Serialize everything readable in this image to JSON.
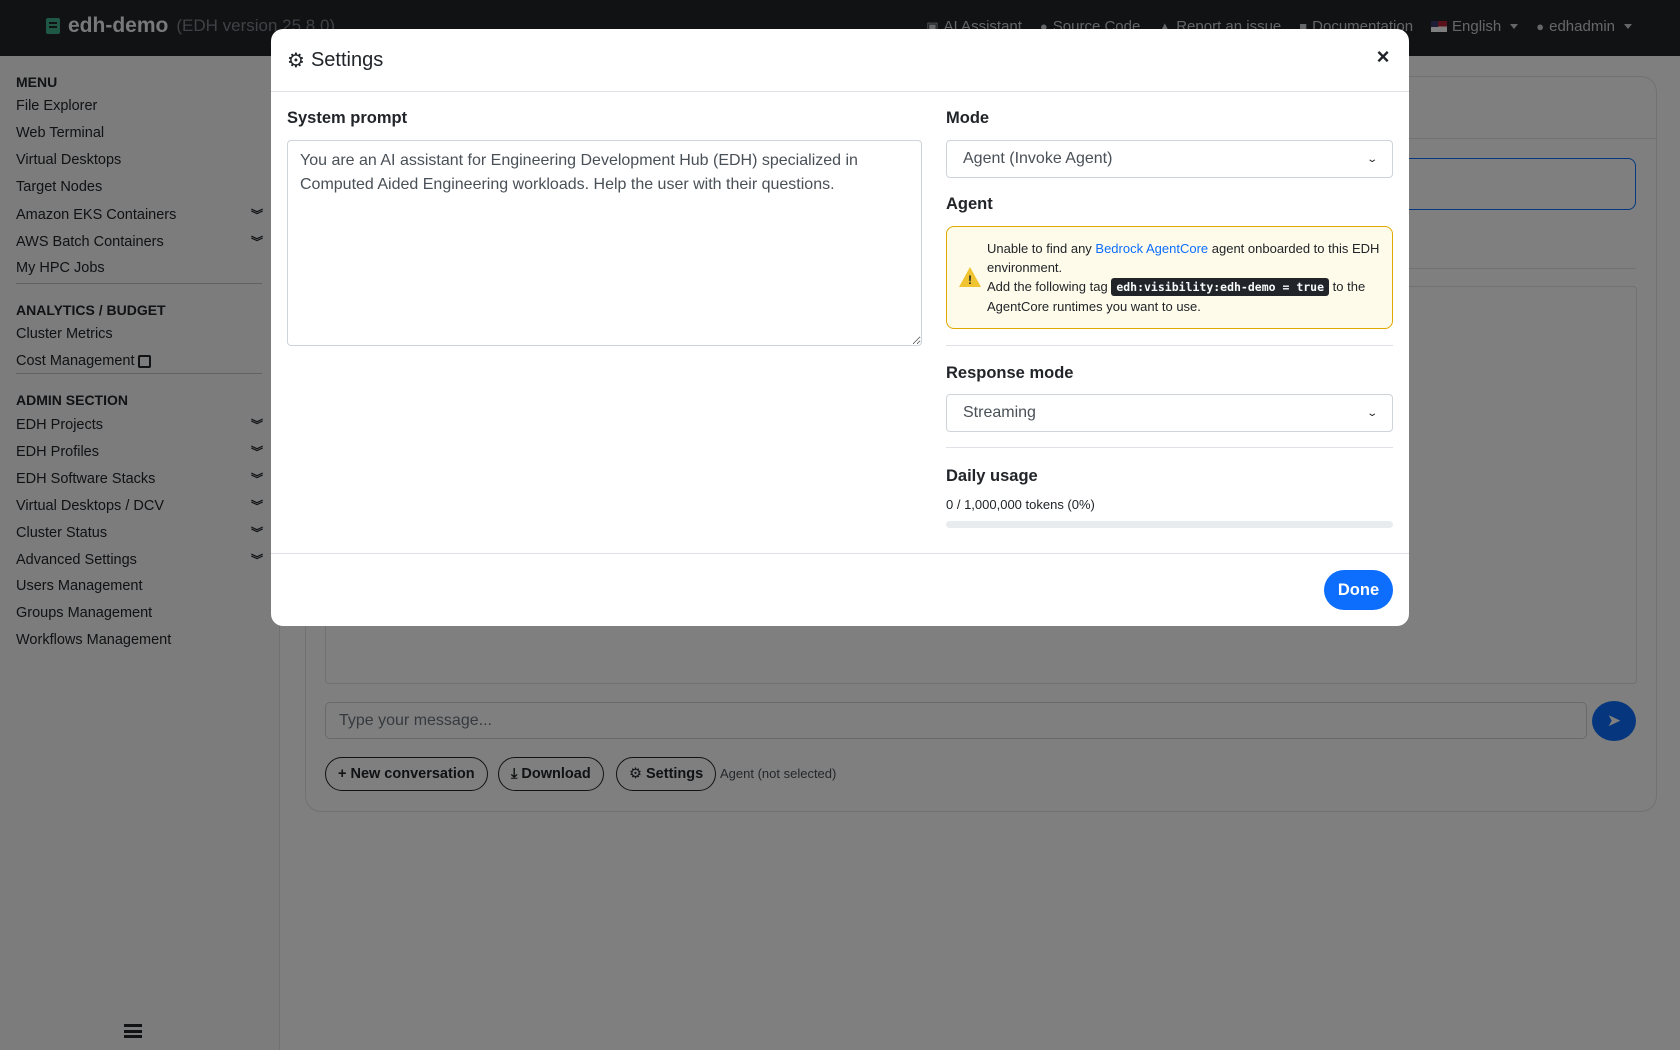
{
  "navbar": {
    "brand": "edh-demo",
    "version": "(EDH version 25.8.0)",
    "links": [
      {
        "label": "AI Assistant",
        "icon": "robot-icon"
      },
      {
        "label": "Source Code",
        "icon": "github-icon"
      },
      {
        "label": "Report an issue",
        "icon": "warning-icon"
      },
      {
        "label": "Documentation",
        "icon": "book-icon"
      }
    ],
    "language": "English",
    "user": "edhadmin"
  },
  "sidebar": {
    "menu_heading": "MENU",
    "menu_items": [
      "File Explorer",
      "Web Terminal",
      "Virtual Desktops",
      "Target Nodes",
      "Amazon EKS Containers",
      "AWS Batch Containers",
      "My HPC Jobs"
    ],
    "analytics_heading": "ANALYTICS / BUDGET",
    "analytics_items": [
      "Cluster Metrics",
      "Cost Management"
    ],
    "admin_heading": "ADMIN SECTION",
    "admin_items": [
      "EDH Projects",
      "EDH Profiles",
      "EDH Software Stacks",
      "Virtual Desktops / DCV",
      "Cluster Status",
      "Advanced Settings",
      "Users Management",
      "Groups Management",
      "Workflows Management"
    ]
  },
  "chat": {
    "input_placeholder": "Type your message...",
    "new_conversation": "New conversation",
    "download": "Download",
    "settings": "Settings",
    "agent_status": "Agent (not selected)"
  },
  "modal": {
    "title": "Settings",
    "close": "×",
    "system_prompt_label": "System prompt",
    "system_prompt_value": "You are an AI assistant for Engineering Development Hub (EDH) specialized in Computed Aided Engineering workloads. Help the user with their questions.",
    "mode_label": "Mode",
    "mode_value": "Agent (Invoke Agent)",
    "agent_label": "Agent",
    "alert_text_1": "Unable to find any ",
    "alert_link": "Bedrock AgentCore",
    "alert_text_2": " agent onboarded to this EDH environment.",
    "alert_text_3": "Add the following tag ",
    "alert_code": "edh:visibility:edh-demo = true",
    "alert_text_4": " to the AgentCore runtimes you want to use.",
    "response_mode_label": "Response mode",
    "response_mode_value": "Streaming",
    "daily_usage_label": "Daily usage",
    "daily_usage_text": "0 / 1,000,000 tokens (0%)",
    "daily_usage_percent": 0,
    "done": "Done"
  },
  "colors": {
    "primary": "#0d6efd",
    "navbar": "#212529",
    "warning_border": "#e0a800",
    "warning_bg": "#fffbea"
  }
}
